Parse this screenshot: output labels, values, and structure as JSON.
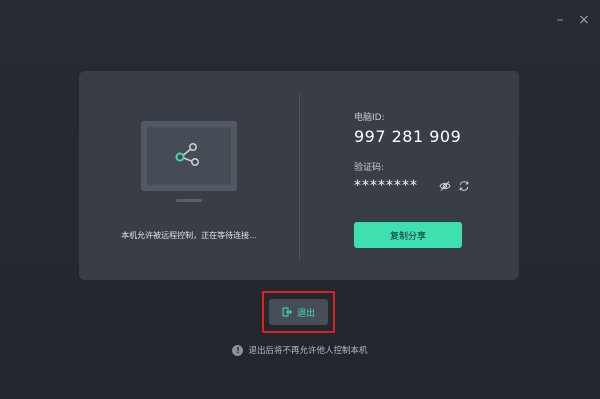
{
  "window": {
    "minimize_glyph": "–",
    "close_glyph": "×"
  },
  "left_panel": {
    "status_text": "本机允许被远程控制，正在等待连接..."
  },
  "right_panel": {
    "device_id_label": "电脑ID:",
    "device_id_value": "997 281 909",
    "code_label": "验证码:",
    "code_value": "********",
    "copy_button_label": "复制分享"
  },
  "exit": {
    "label": "退出"
  },
  "notice": {
    "info_glyph": "!",
    "text": "退出后将不再允许他人控制本机"
  },
  "colors": {
    "accent": "#3fe0b0",
    "card_background": "#393e46",
    "page_background": "#262b33",
    "highlight": "#e02020"
  },
  "icons": [
    "share-icon",
    "eye-off-icon",
    "refresh-icon",
    "exit-door-icon",
    "info-icon"
  ]
}
